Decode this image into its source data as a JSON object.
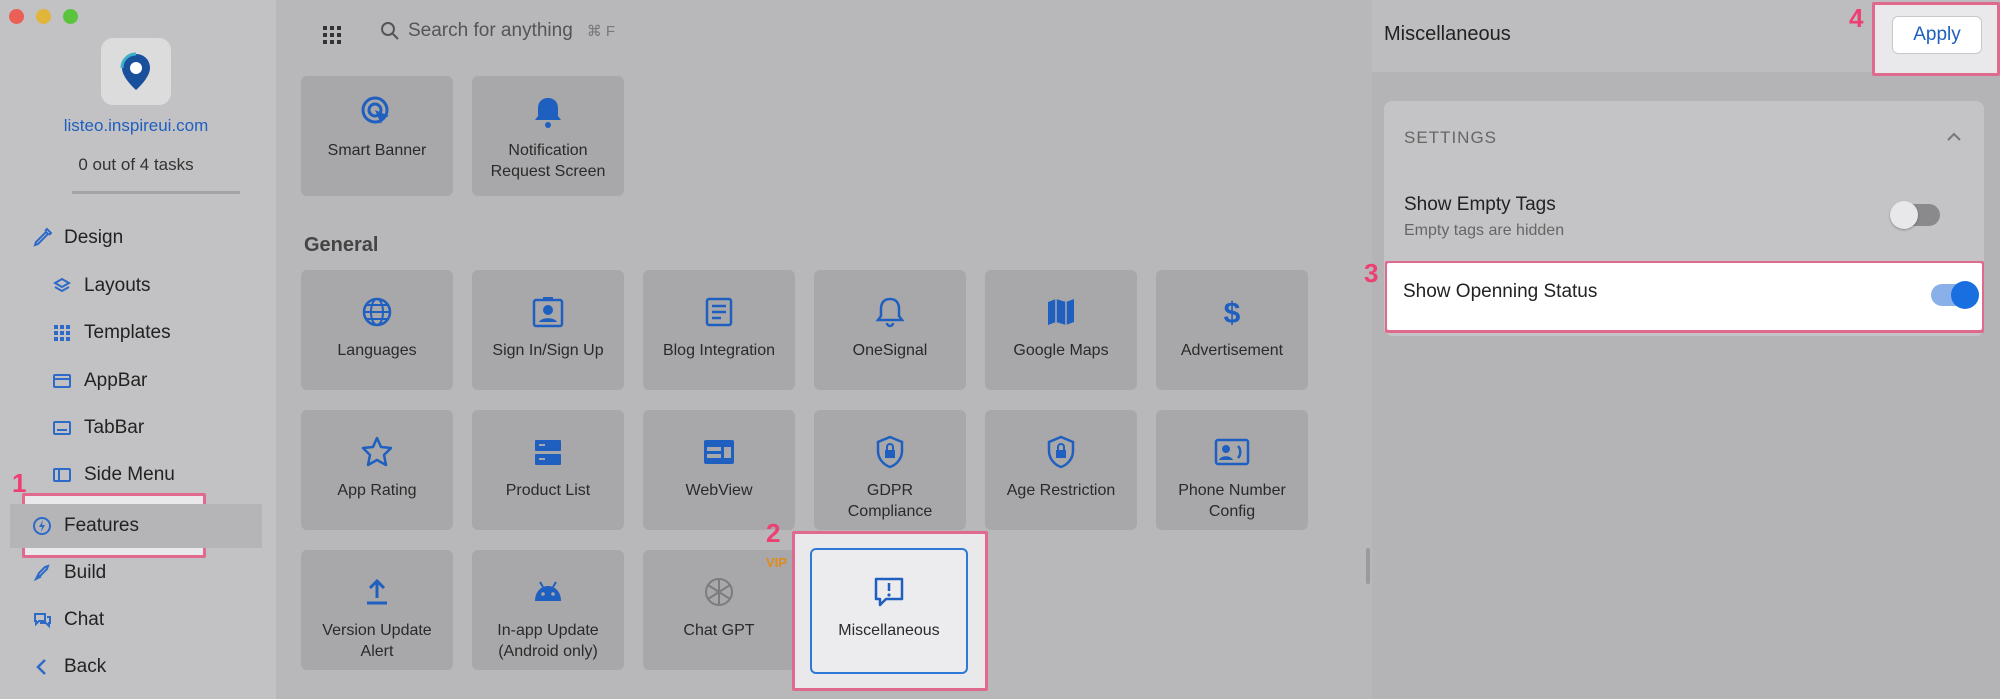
{
  "window_controls": {
    "close_color": "#ec5f57",
    "minimize_color": "#e1b43a",
    "maximize_color": "#5ac43f"
  },
  "sidebar": {
    "site": "listeo.inspireui.com",
    "tasks": "0 out of 4 tasks",
    "items": [
      {
        "label": "Design",
        "icon": "brush-icon"
      },
      {
        "label": "Layouts",
        "icon": "layers-icon"
      },
      {
        "label": "Templates",
        "icon": "template-grid-icon"
      },
      {
        "label": "AppBar",
        "icon": "appbar-icon"
      },
      {
        "label": "TabBar",
        "icon": "tabbar-icon"
      },
      {
        "label": "Side Menu",
        "icon": "side-menu-icon"
      },
      {
        "label": "Features",
        "icon": "bolt-icon"
      },
      {
        "label": "Build",
        "icon": "rocket-icon"
      },
      {
        "label": "Chat",
        "icon": "chat-icon"
      },
      {
        "label": "Back",
        "icon": "back-icon"
      }
    ]
  },
  "search": {
    "placeholder": "Search for anything",
    "shortcut": "⌘ F"
  },
  "tiles_top": [
    {
      "label": "Smart Banner",
      "icon": "target-click-icon"
    },
    {
      "label": "Notification\nRequest Screen",
      "icon": "bell-icon"
    }
  ],
  "section_general": "General",
  "tiles_general": [
    {
      "label": "Languages",
      "icon": "globe-icon"
    },
    {
      "label": "Sign In/Sign Up",
      "icon": "contact-card-icon"
    },
    {
      "label": "Blog Integration",
      "icon": "article-icon"
    },
    {
      "label": "OneSignal",
      "icon": "bell-outline-icon"
    },
    {
      "label": "Google Maps",
      "icon": "map-icon"
    },
    {
      "label": "Advertisement",
      "icon": "dollar-icon"
    },
    {
      "label": "App Rating",
      "icon": "star-icon"
    },
    {
      "label": "Product List",
      "icon": "list-icon"
    },
    {
      "label": "WebView",
      "icon": "webview-icon"
    },
    {
      "label": "GDPR\nCompliance",
      "icon": "shield-lock-icon"
    },
    {
      "label": "Age Restriction",
      "icon": "shield-lock-icon"
    },
    {
      "label": "Phone Number\nConfig",
      "icon": "phone-contact-icon"
    },
    {
      "label": "Version Update\nAlert",
      "icon": "upload-icon"
    },
    {
      "label": "In-app Update\n(Android only)",
      "icon": "android-icon"
    },
    {
      "label": "Chat GPT",
      "icon": "openai-icon"
    },
    {
      "label": "Miscellaneous",
      "icon": "alert-bubble-icon"
    }
  ],
  "vip_badge": "VIP",
  "panel": {
    "title": "Miscellaneous",
    "apply": "Apply",
    "settings_label": "SETTINGS",
    "row1_title": "Show Empty Tags",
    "row1_sub": "Empty tags are hidden",
    "row1_on": false,
    "row2_title": "Show Openning Status",
    "row2_on": true
  },
  "steps": [
    "1",
    "2",
    "3",
    "4"
  ],
  "colors": {
    "accent": "#1a6fe0",
    "highlight": "#e06a8e",
    "step_number": "#ee3f72",
    "vip": "#e08a1a"
  }
}
